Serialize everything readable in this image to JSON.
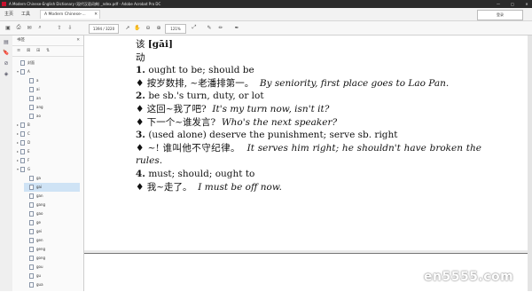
{
  "window": {
    "title": "A Modern Chinese-English Dictionary (现代汉语词典) _ndex.pdf - Adobe Acrobat Pro DC",
    "controls": [
      "—",
      "□",
      "✕"
    ]
  },
  "tabs": {
    "home": "主页",
    "tools": "工具",
    "document": "A Modern Chinese-...",
    "signin": "登录"
  },
  "toolbar": {
    "icons": [
      "save-icon",
      "print-icon",
      "email-icon",
      "search-icon",
      "page-up-icon",
      "page-down-icon",
      "pointer-icon",
      "hand-icon",
      "zoom-out-icon",
      "zoom-in-icon",
      "fit-icon",
      "comment-icon",
      "highlight-icon",
      "sign-icon"
    ],
    "page_input": "1394 / 3220",
    "zoom": "121%"
  },
  "nav_panel": {
    "title": "书签",
    "close": "✕",
    "bookmarks": [
      {
        "label": "封面",
        "toggle": "",
        "level": 0,
        "selected": false
      },
      {
        "label": "A",
        "toggle": "▾",
        "level": 0,
        "selected": false
      },
      {
        "label": "a",
        "toggle": "",
        "level": 1,
        "selected": false
      },
      {
        "label": "ai",
        "toggle": "",
        "level": 1,
        "selected": false
      },
      {
        "label": "an",
        "toggle": "",
        "level": 1,
        "selected": false
      },
      {
        "label": "ang",
        "toggle": "",
        "level": 1,
        "selected": false
      },
      {
        "label": "ao",
        "toggle": "",
        "level": 1,
        "selected": false
      },
      {
        "label": "B",
        "toggle": "▸",
        "level": 0,
        "selected": false
      },
      {
        "label": "C",
        "toggle": "▸",
        "level": 0,
        "selected": false
      },
      {
        "label": "D",
        "toggle": "▸",
        "level": 0,
        "selected": false
      },
      {
        "label": "E",
        "toggle": "▸",
        "level": 0,
        "selected": false
      },
      {
        "label": "F",
        "toggle": "▸",
        "level": 0,
        "selected": false
      },
      {
        "label": "G",
        "toggle": "▾",
        "level": 0,
        "selected": false
      },
      {
        "label": "ga",
        "toggle": "",
        "level": 1,
        "selected": false
      },
      {
        "label": "gai",
        "toggle": "",
        "level": 1,
        "selected": true
      },
      {
        "label": "gan",
        "toggle": "",
        "level": 1,
        "selected": false
      },
      {
        "label": "gang",
        "toggle": "",
        "level": 1,
        "selected": false
      },
      {
        "label": "gao",
        "toggle": "",
        "level": 1,
        "selected": false
      },
      {
        "label": "ge",
        "toggle": "",
        "level": 1,
        "selected": false
      },
      {
        "label": "gei",
        "toggle": "",
        "level": 1,
        "selected": false
      },
      {
        "label": "gen",
        "toggle": "",
        "level": 1,
        "selected": false
      },
      {
        "label": "geng",
        "toggle": "",
        "level": 1,
        "selected": false
      },
      {
        "label": "gong",
        "toggle": "",
        "level": 1,
        "selected": false
      },
      {
        "label": "gou",
        "toggle": "",
        "level": 1,
        "selected": false
      },
      {
        "label": "gu",
        "toggle": "",
        "level": 1,
        "selected": false
      },
      {
        "label": "gua",
        "toggle": "",
        "level": 1,
        "selected": false
      }
    ]
  },
  "entry": {
    "headword": "该",
    "pinyin": "[gāi]",
    "pos": "动",
    "senses": [
      {
        "num": "1.",
        "def": "ought to be; should be",
        "examples": [
          {
            "zh": "♦ 按岁数排, ~老潘排第一。",
            "en": "By seniority, first place goes to Lao Pan."
          }
        ]
      },
      {
        "num": "2.",
        "def": "be sb.'s turn, duty, or lot",
        "examples": [
          {
            "zh": "♦ 这回~我了吧?",
            "en": "It's my turn now, isn't it?"
          },
          {
            "zh": "♦ 下一个~谁发言?",
            "en": "Who's the next speaker?"
          }
        ]
      },
      {
        "num": "3.",
        "def": "(used alone) deserve the punishment; serve sb. right",
        "examples": [
          {
            "zh": "♦ ~! 谁叫他不守纪律。",
            "en_a": "It serves him right; he shouldn't have broken the",
            "en_b": "rules."
          }
        ]
      },
      {
        "num": "4.",
        "def": "must; should; ought to",
        "examples": [
          {
            "zh": "♦ 我~走了。",
            "en": "I must be off now."
          }
        ]
      }
    ]
  },
  "watermark": "en5555.com",
  "colors": {
    "selected_bookmark": "#cfe3f5",
    "title_bar": "#2b2b2b",
    "page": "#ffffff",
    "doc_background": "#e9e9e9"
  }
}
